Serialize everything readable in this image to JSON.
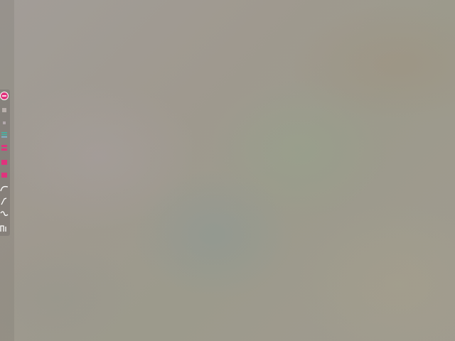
{
  "toolbar": {
    "tools": [
      {
        "icon": "minus-circle-icon",
        "color": "#e0337d"
      },
      {
        "icon": "square-icon",
        "color": "#b9b0ac"
      },
      {
        "icon": "small-square-icon",
        "color": "#b2a8ac"
      },
      {
        "icon": "lines-icon",
        "color": "#3fb8a8"
      },
      {
        "icon": "pink-bars-icon",
        "color": "#e0337d"
      },
      {
        "icon": "pink-block-icon",
        "color": "#e0337d"
      },
      {
        "icon": "pink-block-icon",
        "color": "#e0337d"
      },
      {
        "icon": "curve-icon",
        "color": "#ffffff"
      },
      {
        "icon": "diagonal-line-icon",
        "color": "#ffffff"
      },
      {
        "icon": "wave-icon",
        "color": "#ffffff"
      },
      {
        "icon": "step-icon",
        "color": "#ffffff"
      }
    ]
  }
}
